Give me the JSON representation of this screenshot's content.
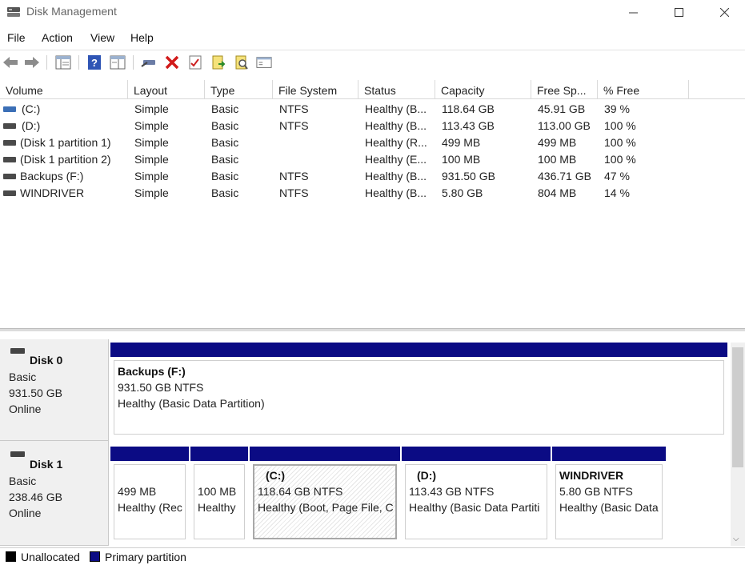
{
  "window": {
    "title": "Disk Management"
  },
  "menu": [
    "File",
    "Action",
    "View",
    "Help"
  ],
  "toolbar_icons": [
    "back-arrow-icon",
    "forward-arrow-icon",
    "console-tree-icon",
    "help-icon",
    "properties-pane-icon",
    "connect-disk-icon",
    "delete-icon",
    "checklist-icon",
    "export-icon",
    "search-icon",
    "settings-pane-icon"
  ],
  "columns": [
    "Volume",
    "Layout",
    "Type",
    "File System",
    "Status",
    "Capacity",
    "Free Sp...",
    "% Free"
  ],
  "volumes": [
    {
      "volume": "(C:)",
      "layout": "Simple",
      "type": "Basic",
      "fs": "NTFS",
      "status": "Healthy (B...",
      "capacity": "118.64 GB",
      "free": "45.91 GB",
      "pct": "39 %",
      "system": true
    },
    {
      "volume": "(D:)",
      "layout": "Simple",
      "type": "Basic",
      "fs": "NTFS",
      "status": "Healthy (B...",
      "capacity": "113.43 GB",
      "free": "113.00 GB",
      "pct": "100 %"
    },
    {
      "volume": "(Disk 1 partition 1)",
      "layout": "Simple",
      "type": "Basic",
      "fs": "",
      "status": "Healthy (R...",
      "capacity": "499 MB",
      "free": "499 MB",
      "pct": "100 %"
    },
    {
      "volume": "(Disk 1 partition 2)",
      "layout": "Simple",
      "type": "Basic",
      "fs": "",
      "status": "Healthy (E...",
      "capacity": "100 MB",
      "free": "100 MB",
      "pct": "100 %"
    },
    {
      "volume": "Backups (F:)",
      "layout": "Simple",
      "type": "Basic",
      "fs": "NTFS",
      "status": "Healthy (B...",
      "capacity": "931.50 GB",
      "free": "436.71 GB",
      "pct": "47 %"
    },
    {
      "volume": "WINDRIVER",
      "layout": "Simple",
      "type": "Basic",
      "fs": "NTFS",
      "status": "Healthy (B...",
      "capacity": "5.80 GB",
      "free": "804 MB",
      "pct": "14 %"
    }
  ],
  "disks": [
    {
      "name": "Disk 0",
      "type": "Basic",
      "size": "931.50 GB",
      "state": "Online",
      "partitions": [
        {
          "title": "Backups  (F:)",
          "size": "931.50 GB NTFS",
          "status": "Healthy (Basic Data Partition)"
        }
      ]
    },
    {
      "name": "Disk 1",
      "type": "Basic",
      "size": "238.46 GB",
      "state": "Online",
      "partitions": [
        {
          "title": "",
          "size": "499 MB",
          "status": "Healthy (Rec"
        },
        {
          "title": "",
          "size": "100 MB",
          "status": "Healthy"
        },
        {
          "title": "(C:)",
          "size": "118.64 GB NTFS",
          "status": "Healthy (Boot, Page File, C",
          "selected": true
        },
        {
          "title": "(D:)",
          "size": "113.43 GB NTFS",
          "status": "Healthy (Basic Data Partiti"
        },
        {
          "title": "WINDRIVER",
          "size": "5.80 GB NTFS",
          "status": "Healthy (Basic Data"
        }
      ]
    }
  ],
  "legend": [
    {
      "label": "Unallocated",
      "color": "#000000"
    },
    {
      "label": "Primary partition",
      "color": "#0b0b84"
    }
  ]
}
